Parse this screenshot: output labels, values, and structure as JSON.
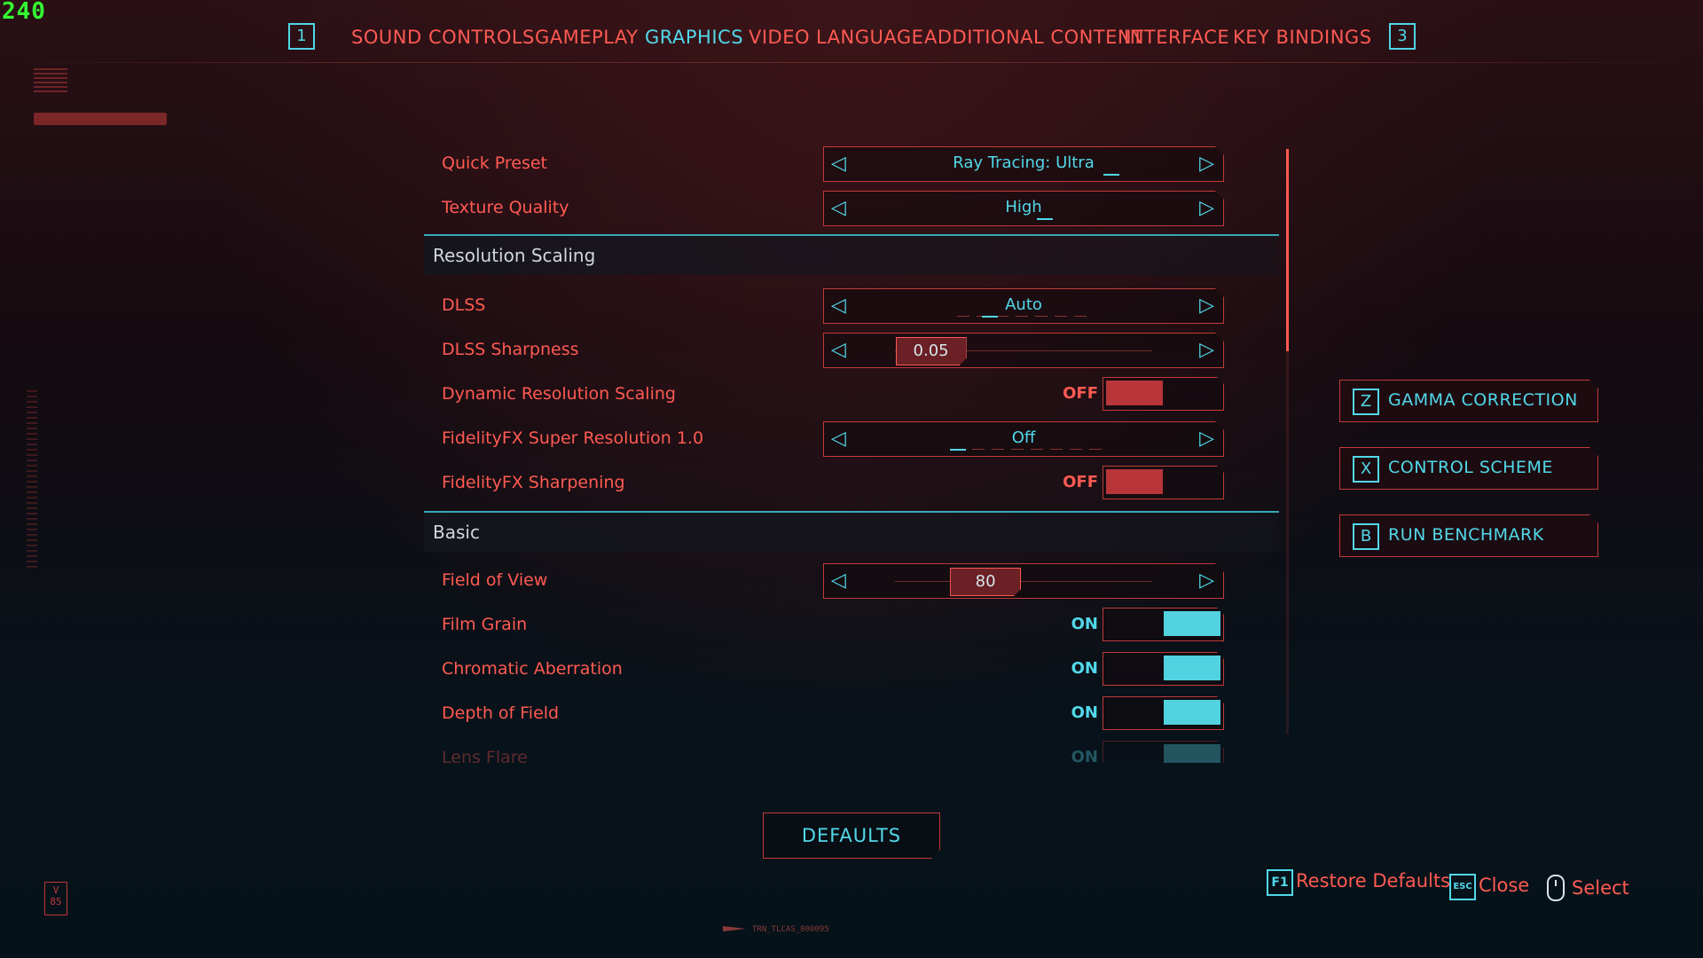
{
  "fps_counter": "240",
  "nav": {
    "prev_key": "1",
    "next_key": "3",
    "tabs": [
      "SOUND",
      "CONTROLS",
      "GAMEPLAY",
      "GRAPHICS",
      "VIDEO",
      "LANGUAGE",
      "ADDITIONAL CONTENT",
      "INTERFACE",
      "KEY BINDINGS"
    ],
    "active_tab": "GRAPHICS"
  },
  "settings": {
    "quick_preset": {
      "label": "Quick Preset",
      "value": "Ray Tracing: Ultra"
    },
    "texture_quality": {
      "label": "Texture Quality",
      "value": "High"
    },
    "section_resolution": "Resolution Scaling",
    "dlss": {
      "label": "DLSS",
      "value": "Auto"
    },
    "dlss_sharpness": {
      "label": "DLSS Sharpness",
      "value": "0.05",
      "fraction": 0.05
    },
    "dynamic_resolution": {
      "label": "Dynamic Resolution Scaling",
      "state": "OFF"
    },
    "fsr": {
      "label": "FidelityFX Super Resolution 1.0",
      "value": "Off"
    },
    "fidelityfx_sharpening": {
      "label": "FidelityFX Sharpening",
      "state": "OFF"
    },
    "section_basic": "Basic",
    "field_of_view": {
      "label": "Field of View",
      "value": "80",
      "fraction": 0.34
    },
    "film_grain": {
      "label": "Film Grain",
      "state": "ON"
    },
    "chromatic_aberration": {
      "label": "Chromatic Aberration",
      "state": "ON"
    },
    "depth_of_field": {
      "label": "Depth of Field",
      "state": "ON"
    },
    "lens_flare": {
      "label": "Lens Flare",
      "state": "ON"
    }
  },
  "side_buttons": [
    {
      "key": "Z",
      "label": "GAMMA CORRECTION"
    },
    {
      "key": "X",
      "label": "CONTROL SCHEME"
    },
    {
      "key": "B",
      "label": "RUN BENCHMARK"
    }
  ],
  "defaults_button": "DEFAULTS",
  "hints": {
    "restore": {
      "key": "F1",
      "label": "Restore Defaults"
    },
    "close": {
      "key": "ESC",
      "label": "Close"
    },
    "select": {
      "label": "Select"
    }
  },
  "footer_code": "TRN_TLCAS_800095",
  "badge": "V 85",
  "colors": {
    "accent_red": "#ff5a52",
    "accent_cyan": "#52d8ea",
    "toggle_off": "#b8353a",
    "toggle_on": "#52d2e0"
  }
}
